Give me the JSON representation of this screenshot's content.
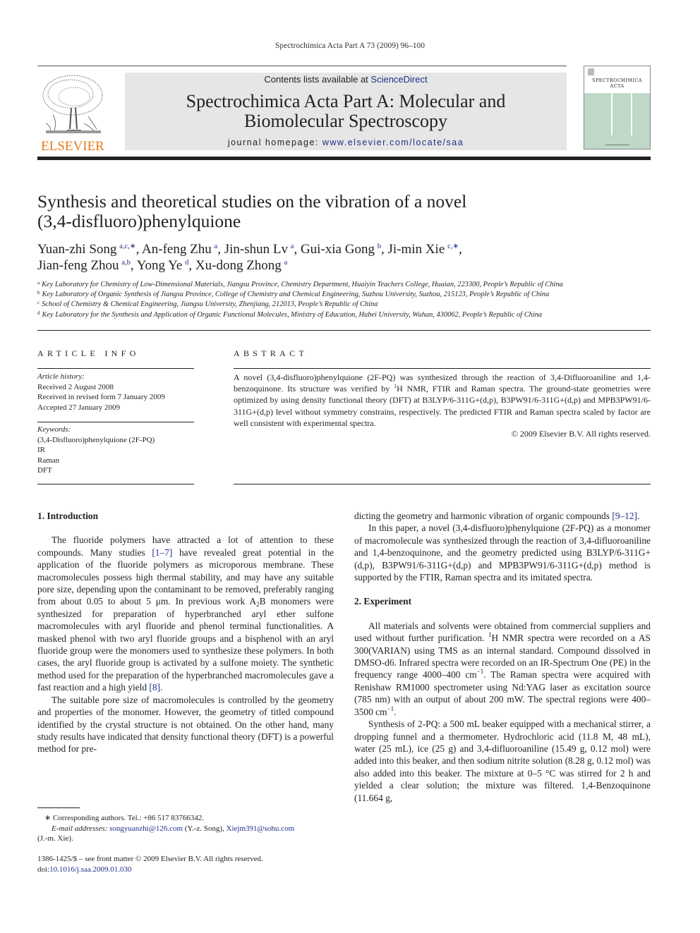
{
  "running_head": "Spectrochimica Acta Part A 73 (2009) 96–100",
  "masthead": {
    "publisher_logo": "ELSEVIER",
    "contents_prefix": "Contents lists available at ",
    "contents_link": "ScienceDirect",
    "journal_title_line1": "Spectrochimica Acta Part A: Molecular and",
    "journal_title_line2": "Biomolecular Spectroscopy",
    "homepage_prefix": "journal homepage: ",
    "homepage_link": "www.elsevier.com/locate/saa",
    "cover_title_line1": "SPECTROCHIMICA",
    "cover_title_line2": "ACTA"
  },
  "article": {
    "title_line1": "Synthesis and theoretical studies on the vibration of a novel",
    "title_line2": "(3,4-disfluoro)phenylquione",
    "authors": [
      {
        "name": "Yuan-zhi Song",
        "sup": "a,c,∗",
        "sep": ", "
      },
      {
        "name": "An-feng Zhu",
        "sup": "a",
        "sep": ", "
      },
      {
        "name": "Jin-shun Lv",
        "sup": "a",
        "sep": ", "
      },
      {
        "name": "Gui-xia Gong",
        "sup": "b",
        "sep": ", "
      },
      {
        "name": "Ji-min Xie",
        "sup": "c,∗",
        "sep": ","
      },
      {
        "name": "Jian-feng Zhou",
        "sup": "a,b",
        "sep": ", "
      },
      {
        "name": "Yong Ye",
        "sup": "d",
        "sep": ", "
      },
      {
        "name": "Xu-dong Zhong",
        "sup": "a",
        "sep": ""
      }
    ],
    "affiliations": [
      {
        "key": "a",
        "text": "Key Laboratory for Chemistry of Low-Dimensional Materials, Jiangsu Province, Chemistry Department, Huaiyin Teachers College, Huaian, 223300, People’s Republic of China"
      },
      {
        "key": "b",
        "text": "Key Laboratory of Organic Synthesis of Jiangsu Province, College of Chemistry and Chemical Engineering, Suzhou University, Suzhou, 215123, People’s Republic of China"
      },
      {
        "key": "c",
        "text": "School of Chemistry & Chemical Engineering, Jiangsu University, Zhenjiang, 212013, People’s Republic of China"
      },
      {
        "key": "d",
        "text": "Key Laboratory for the Synthesis and Application of Organic Functional Molecules, Ministry of Education, Hubei University, Wuhan, 430062, People’s Republic of China"
      }
    ]
  },
  "article_info": {
    "heading": "ARTICLE INFO",
    "history_label": "Article history:",
    "history": [
      "Received 2 August 2008",
      "Received in revised form 7 January 2009",
      "Accepted 27 January 2009"
    ],
    "keywords_label": "Keywords:",
    "keywords": [
      "(3,4-Disfluoro)phenylquione (2F-PQ)",
      "IR",
      "Raman",
      "DFT"
    ]
  },
  "abstract": {
    "heading": "ABSTRACT",
    "text_part1": "A novel (3,4-disfluoro)phenylquione (2F-PQ) was synthesized through the reaction of 3,4-Difluoroaniline and 1,4-benzoquinone. Its structure was verified by ",
    "sup1": "1",
    "text_part2": "H NMR, FTIR and Raman spectra. The ground-state geometries were optimized by using density functional theory (DFT) at B3LYP/6-311G+(d,p), B3PW91/6-311G+(d,p) and MPB3PW91/6-311G+(d,p) level without symmetry constrains, respectively. The predicted FTIR and Raman spectra scaled by factor are well consistent with experimental spectra.",
    "copyright": "© 2009 Elsevier B.V. All rights reserved."
  },
  "body": {
    "sec1_heading": "1.  Introduction",
    "p1_a": "The fluoride polymers have attracted a lot of attention to these compounds. Many studies ",
    "p1_ref1": "[1–7]",
    "p1_b": " have revealed great potential in the application of the fluoride polymers as microporous membrane. These macromolecules possess high thermal stability, and may have any suitable pore size, depending upon the contaminant to be removed, preferably ranging from about 0.05 to about 5 μm. In previous work A",
    "p1_sub": "2",
    "p1_c": "B monomers were synthesized for preparation of hyperbranched aryl ether sulfone macromolecules with aryl fluoride and phenol terminal functionalities. A masked phenol with two aryl fluoride groups and a bisphenol with an aryl fluoride group were the monomers used to synthesize these polymers. In both cases, the aryl fluoride group is activated by a sulfone moiety. The synthetic method used for the preparation of the hyperbranched macromolecules gave a fast reaction and a high yield ",
    "p1_ref2": "[8]",
    "p1_d": ".",
    "p2": "The suitable pore size of macromolecules is controlled by the geometry and properties of the monomer. However, the geometry of titled compound identified by the crystal structure is not obtained. On the other hand, many study results have indicated that density functional theory (DFT) is a powerful method for pre-",
    "p2_cont": "dicting the geometry and harmonic vibration of organic compounds ",
    "p2_ref": "[9–12]",
    "p2_end": ".",
    "p3": "In this paper, a novel (3,4-disfluoro)phenylquione (2F-PQ) as a monomer of macromolecule was synthesized through the reaction of 3,4-difluoroaniline and 1,4-benzoquinone, and the geometry predicted using B3LYP/6-311G+(d,p), B3PW91/6-311G+(d,p) and MPB3PW91/6-311G+(d,p) method is supported by the FTIR, Raman spectra and its imitated spectra.",
    "sec2_heading": "2.  Experiment",
    "p4_a": "All materials and solvents were obtained from commercial suppliers and used without further purification. ",
    "p4_sup1": "1",
    "p4_b": "H NMR spectra were recorded on a AS 300(VARIAN) using TMS as an internal standard. Compound dissolved in DMSO-d6. Infrared spectra were recorded on an IR-Spectrum One (PE) in the frequency range 4000–400 cm",
    "p4_sup2": "−1",
    "p4_c": ". The Raman spectra were acquired with Renishaw RM1000 spectrometer using Nd:YAG laser as excitation source (785 nm) with an output of about 200 mW. The spectral regions were 400–3500 cm",
    "p4_sup3": "−1",
    "p4_d": ".",
    "p5": "Synthesis of 2-PQ: a 500 mL beaker equipped with a mechanical stirrer, a dropping funnel and a thermometer. Hydrochloric acid (11.8 M, 48 mL), water (25 mL), ice (25 g) and 3,4-difluoroaniline (15.49 g, 0.12 mol) were added into this beaker, and then sodium nitrite solution (8.28 g, 0.12 mol) was also added into this beaker. The mixture at 0–5 °C was stirred for 2 h and yielded a clear solution; the mixture was filtered. 1,4-Benzoquinone (11.664 g,"
  },
  "footnotes": {
    "corresponding": "∗  Corresponding authors. Tel.: +86 517 83766342.",
    "email_label": "E-mail addresses:",
    "email1": "songyuanzhi@126.com",
    "email1_owner": " (Y.-z. Song), ",
    "email2": "Xiejm391@sohu.com",
    "email2_owner": "(J.-m. Xie).",
    "issn_line": "1386-1425/$ – see front matter © 2009 Elsevier B.V. All rights reserved.",
    "doi_prefix": "doi:",
    "doi": "10.1016/j.saa.2009.01.030"
  },
  "colors": {
    "link": "#1f2f8a",
    "elsevier_orange": "#e87a1c",
    "masthead_bg": "#e6e6e6",
    "cover_green": "#bfd8c8"
  }
}
